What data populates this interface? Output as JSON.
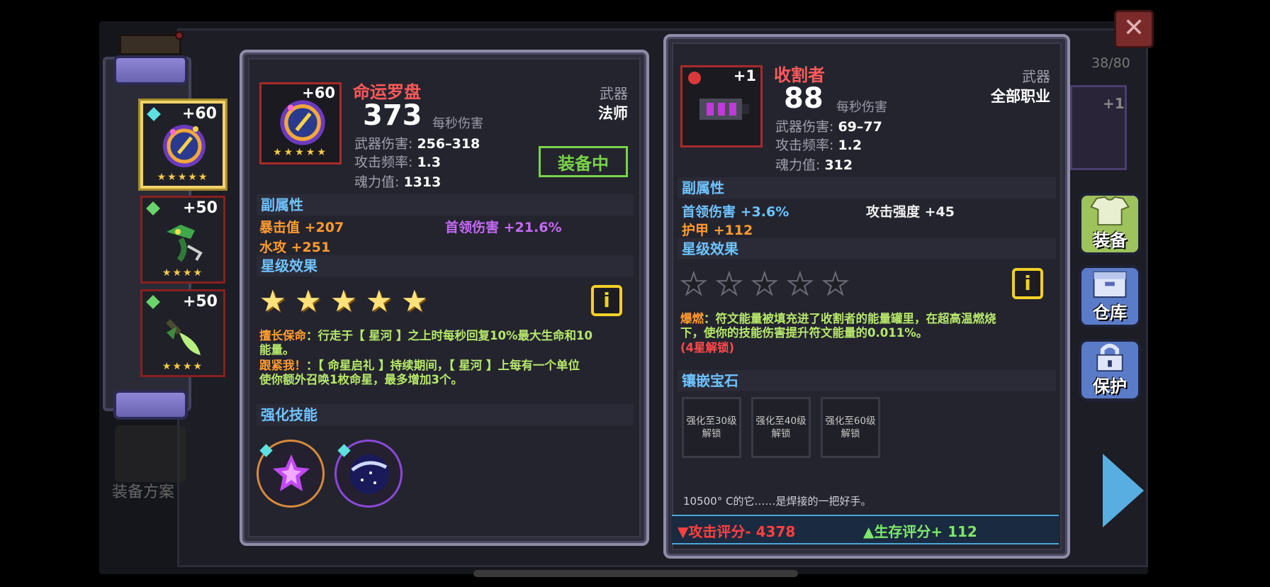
{
  "inventory_count": "38/80",
  "close_symbol": "✕",
  "left_column": {
    "slots": [
      {
        "level": "+60",
        "stars": "★★★★★",
        "selected": true
      },
      {
        "level": "+50",
        "stars": "★★★★",
        "selected": false
      },
      {
        "level": "+50",
        "stars": "★★★★",
        "selected": false
      }
    ],
    "loadout_label": "装备方案"
  },
  "left_panel": {
    "level": "+60",
    "icon_stars": "★★★★★",
    "name": "命运罗盘",
    "dps": "373",
    "dps_label": "每秒伤害",
    "type": "武器",
    "class": "法师",
    "damage_label": "武器伤害:",
    "damage": "256–318",
    "rate_label": "攻击频率:",
    "rate": "1.3",
    "soul_label": "魂力值:",
    "soul": "1313",
    "equipped": "装备中",
    "sub_title": "副属性",
    "subs": [
      {
        "label": "暴击值",
        "value": "+207"
      },
      {
        "label": "首领伤害",
        "value": "+21.6%"
      },
      {
        "label": "水攻",
        "value": "+251"
      }
    ],
    "star_title": "星级效果",
    "star_count": 5,
    "info_symbol": "i",
    "effect1_name": "擅长保命",
    "effect1_text": "：行走于【 星河 】之上时每秒回复10%最大生命和10",
    "effect1_text2": "能量。",
    "effect2_name": "跟紧我！",
    "effect2_text": "：【 命星启礼 】持续期间，【 星河 】上每有一个单位",
    "effect2_text2": "使你额外召唤1枚命星，最多增加3个。",
    "skill_title": "强化技能"
  },
  "right_panel": {
    "level": "+1",
    "name": "收割者",
    "dps": "88",
    "dps_label": "每秒伤害",
    "type": "武器",
    "class": "全部职业",
    "damage_label": "武器伤害:",
    "damage": "69–77",
    "rate_label": "攻击频率:",
    "rate": "1.2",
    "soul_label": "魂力值:",
    "soul": "312",
    "sub_title": "副属性",
    "subs": [
      {
        "label": "首领伤害",
        "value": "+3.6%"
      },
      {
        "label": "攻击强度",
        "value": "+45"
      },
      {
        "label": "护甲",
        "value": "+112"
      }
    ],
    "star_title": "星级效果",
    "star_count": 5,
    "info_symbol": "i",
    "effect_name": "爆燃",
    "effect_text": "：符文能量被填充进了收割者的能量罐里，在超高温燃烧",
    "effect_text2": "下，使你的技能伤害提升符文能量的0.011%。",
    "effect_lock": "(4星解锁)",
    "gem_title": "镶嵌宝石",
    "gem_slots": [
      {
        "line1": "强化至30级",
        "line2": "解锁"
      },
      {
        "line1": "强化至40级",
        "line2": "解锁"
      },
      {
        "line1": "强化至60级",
        "line2": "解锁"
      }
    ],
    "flavor": "10500° C的它……是焊接的一把好手。",
    "attack_score": "▼攻击评分- 4378",
    "survival_score": "▲生存评分+ 112"
  },
  "side_buttons": {
    "equip": "装备",
    "storage": "仓库",
    "protect": "保护"
  },
  "behind_card_level": "+1",
  "colors": {
    "accent_red": "#ff5a5a",
    "equipped_green": "#78d34a",
    "section_blue": "#6ec4ff",
    "stat_orange": "#ff9b2f",
    "stat_purple": "#c56af5"
  }
}
